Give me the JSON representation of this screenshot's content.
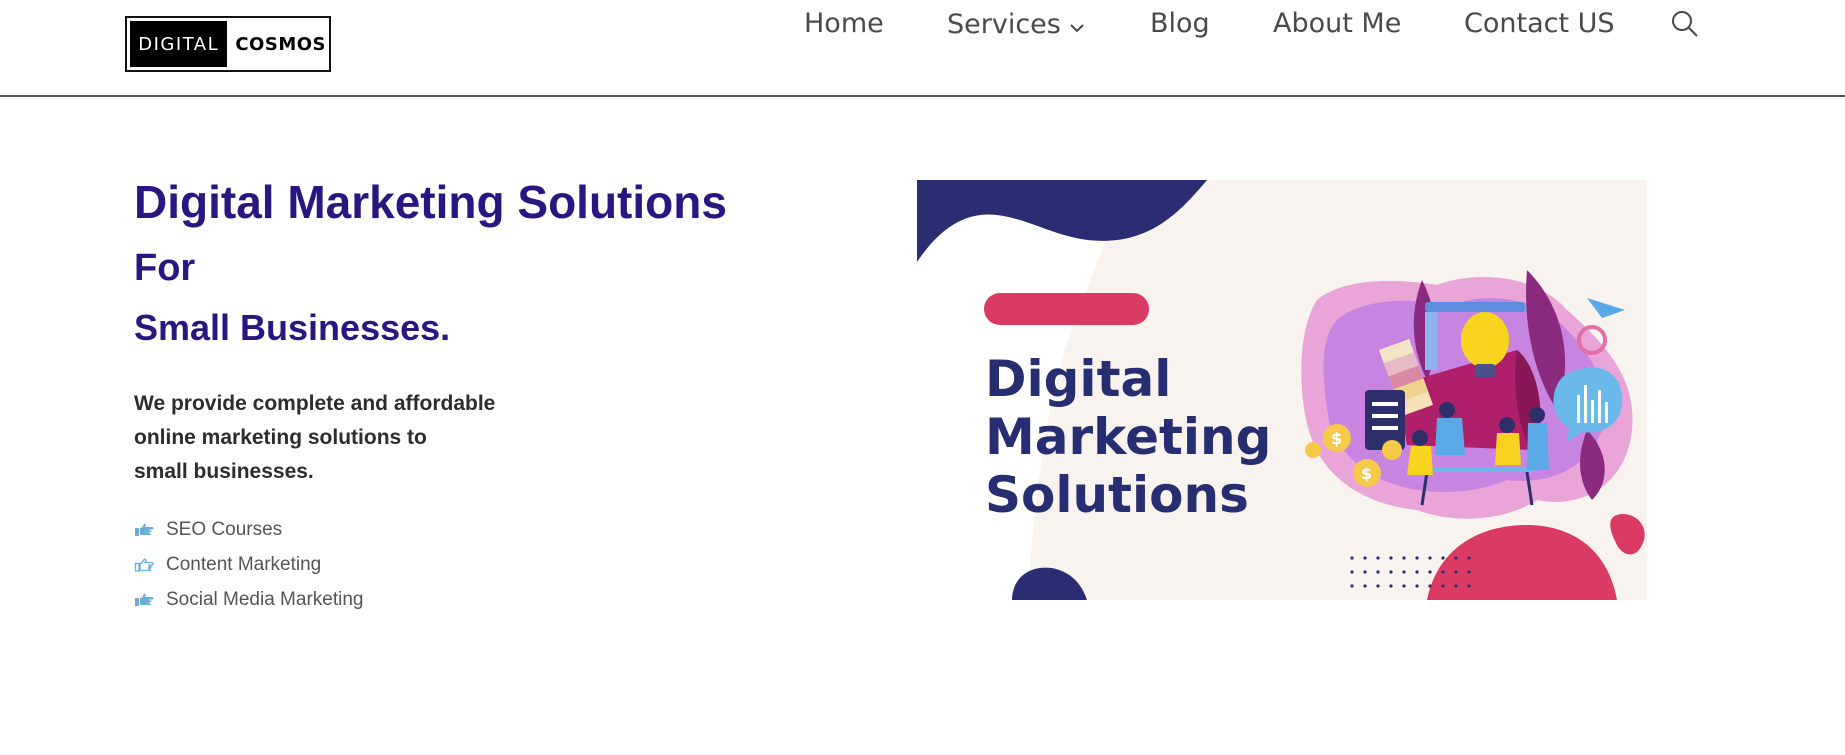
{
  "logo": {
    "left_text": "DIGITAL",
    "right_text": "COSMOS"
  },
  "nav": {
    "items": [
      {
        "label": "Home"
      },
      {
        "label": "Services"
      },
      {
        "label": "Blog"
      },
      {
        "label": "About Me"
      },
      {
        "label": "Contact US"
      }
    ]
  },
  "hero": {
    "title": "Digital Marketing Solutions",
    "subtitle_line1": "For",
    "subtitle_line2": "Small Businesses.",
    "description": [
      "We provide complete and affordable",
      "online marketing solutions to",
      "small businesses."
    ],
    "features": [
      {
        "label": "SEO Courses",
        "icon": "pointing-hand-icon"
      },
      {
        "label": "Content Marketing",
        "icon": "pointing-hand-outline-icon"
      },
      {
        "label": "Social Media Marketing",
        "icon": "pointing-hand-icon"
      }
    ]
  },
  "banner": {
    "title_lines": [
      "Digital",
      "Marketing",
      "Solutions"
    ]
  },
  "colors": {
    "heading": "#2a1680",
    "banner_navy": "#262d70",
    "banner_pink": "#d93b63",
    "banner_cream": "#f8f3ee",
    "hand_icon": "#6aaed6"
  }
}
